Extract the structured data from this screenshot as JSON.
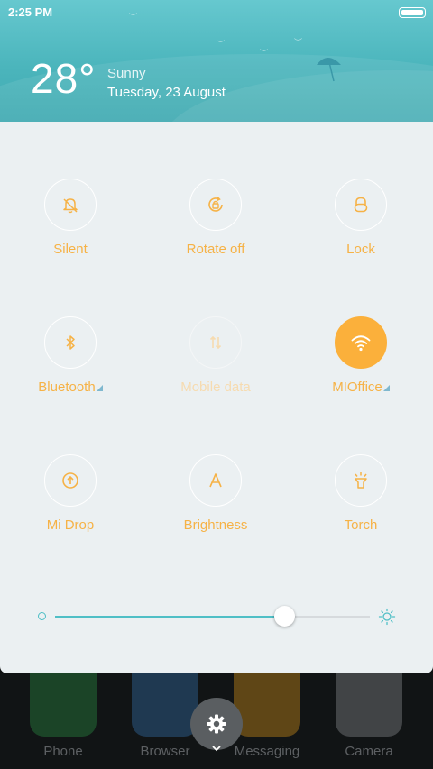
{
  "status_bar": {
    "time": "2:25 PM"
  },
  "weather": {
    "temperature": "28°",
    "condition": "Sunny",
    "date": "Tuesday, 23 August"
  },
  "toggles": [
    {
      "label": "Silent",
      "icon": "bell-off-icon",
      "state": "off"
    },
    {
      "label": "Rotate off",
      "icon": "rotate-lock-icon",
      "state": "off"
    },
    {
      "label": "Lock",
      "icon": "lock-icon",
      "state": "off"
    },
    {
      "label": "Bluetooth",
      "icon": "bluetooth-icon",
      "state": "off",
      "has_submenu": true
    },
    {
      "label": "Mobile data",
      "icon": "mobile-data-icon",
      "state": "disabled"
    },
    {
      "label": "MIOffice",
      "icon": "wifi-icon",
      "state": "on",
      "has_submenu": true
    },
    {
      "label": "Mi Drop",
      "icon": "mi-drop-icon",
      "state": "off"
    },
    {
      "label": "Brightness",
      "icon": "auto-brightness-icon",
      "state": "off"
    },
    {
      "label": "Torch",
      "icon": "torch-icon",
      "state": "off"
    }
  ],
  "brightness": {
    "level": 0.73
  },
  "dock": {
    "apps": [
      {
        "label": "Phone",
        "color": "#2e9e4a"
      },
      {
        "label": "Browser",
        "color": "#3a7fc4"
      },
      {
        "label": "Messaging",
        "color": "#f0a21b"
      },
      {
        "label": "Camera",
        "color": "#9a9ea2"
      }
    ]
  },
  "colors": {
    "accent": "#fbb03b",
    "teal": "#4fbfc6",
    "panel": "#ebf0f2"
  }
}
